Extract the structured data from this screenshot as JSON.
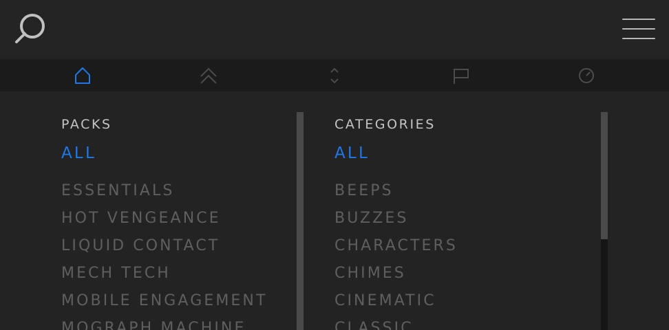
{
  "header": {
    "search_icon": "search-icon",
    "menu_icon": "hamburger-menu-icon"
  },
  "tabs": [
    {
      "icon": "home-icon",
      "active": true
    },
    {
      "icon": "chevrons-up-icon",
      "active": false
    },
    {
      "icon": "sort-icon",
      "active": false
    },
    {
      "icon": "flag-icon",
      "active": false
    },
    {
      "icon": "clock-icon",
      "active": false
    }
  ],
  "packs": {
    "heading": "PACKS",
    "all_label": "ALL",
    "items": [
      "ESSENTIALS",
      "HOT VENGEANCE",
      "LIQUID CONTACT",
      "MECH TECH",
      "MOBILE ENGAGEMENT",
      "MOGRAPH MACHINE"
    ]
  },
  "categories": {
    "heading": "CATEGORIES",
    "all_label": "ALL",
    "items": [
      "BEEPS",
      "BUZZES",
      "CHARACTERS",
      "CHIMES",
      "CINEMATIC",
      "CLASSIC"
    ]
  },
  "colors": {
    "accent": "#1f78e6",
    "background": "#232324",
    "tabbar": "#1b1b1c",
    "heading": "#c4c4c4",
    "item": "#5f5f60",
    "icon_inactive": "#4c4c4d"
  }
}
